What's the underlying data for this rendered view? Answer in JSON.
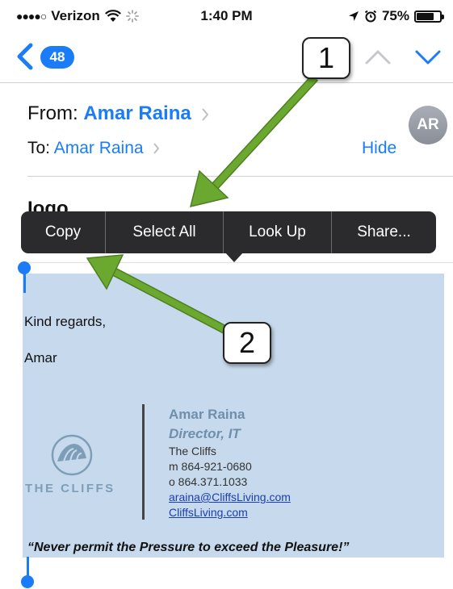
{
  "status_bar": {
    "carrier": "Verizon",
    "time": "1:40 PM",
    "battery": "75%",
    "battery_level": 0.75
  },
  "nav": {
    "unread_count": "48"
  },
  "header": {
    "from_label": "From:",
    "from_name": "Amar Raina",
    "to_label": "To:",
    "to_name": "Amar Raina",
    "hide": "Hide",
    "avatar_initials": "AR"
  },
  "subject_peek": "Iogo",
  "context_menu": {
    "items": [
      "Copy",
      "Select All",
      "Look Up",
      "Share..."
    ]
  },
  "body": {
    "regards": "Kind regards,",
    "signoff": "Amar"
  },
  "signature": {
    "logo_text": "THE CLIFFS",
    "name": "Amar Raina",
    "title": "Director, IT",
    "company": "The Cliffs",
    "mobile": "m 864-921-0680",
    "office": "o  864.371.1033",
    "email": "araina@CliffsLiving.com",
    "website": "CliffsLiving.com"
  },
  "quote": "“Never permit the Pressure to exceed the Pleasure!”",
  "callouts": [
    "1",
    "2"
  ],
  "colors": {
    "accent": "#1a7cf7",
    "selection": "#c7d9ec",
    "menu": "#2b2b2d",
    "arrow": "#6aa830"
  }
}
